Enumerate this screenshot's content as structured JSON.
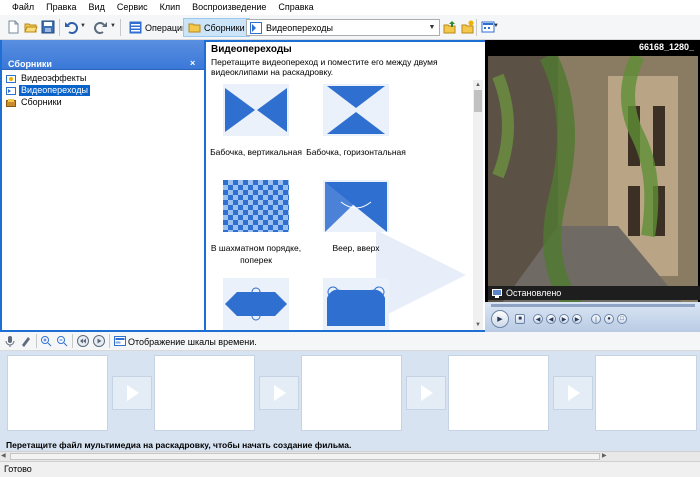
{
  "menu": [
    "Файл",
    "Правка",
    "Вид",
    "Сервис",
    "Клип",
    "Воспроизведение",
    "Справка"
  ],
  "toolbar": {
    "operations_label": "Операции",
    "collections_label": "Сборники",
    "combo_value": "Видеопереходы"
  },
  "left_pane": {
    "title": "Сборники",
    "close_glyph": "×",
    "items": [
      {
        "label": "Видеоэффекты",
        "icon": "video-effects-icon"
      },
      {
        "label": "Видеопереходы",
        "icon": "video-transitions-icon",
        "selected": true
      },
      {
        "label": "Сборники",
        "icon": "collections-icon"
      }
    ]
  },
  "content": {
    "title": "Видеопереходы",
    "description": "Перетащите видеопереход и поместите его между двумя видеоклипами на раскадровку.",
    "tiles": [
      {
        "caption": "Бабочка, вертикальная"
      },
      {
        "caption": "Бабочка, горизонтальная"
      },
      {
        "caption": "В шахматном порядке, поперек"
      },
      {
        "caption": "Веер, вверх"
      },
      {
        "caption": ""
      },
      {
        "caption": ""
      }
    ]
  },
  "preview": {
    "file_name": "66168_1280_",
    "status": "Остановлено"
  },
  "storyboard": {
    "toolbar_label": "Отображение шкалы времени.",
    "hint": "Перетащите файл мультимедиа на раскадровку, чтобы начать создание фильма."
  },
  "status_bar": {
    "text": "Готово"
  },
  "colors": {
    "accent": "#1e6fd3",
    "selection": "#0a63c9",
    "storyboard_bg": "#d7e3f1",
    "transition_blue": "#2f6fd0"
  }
}
